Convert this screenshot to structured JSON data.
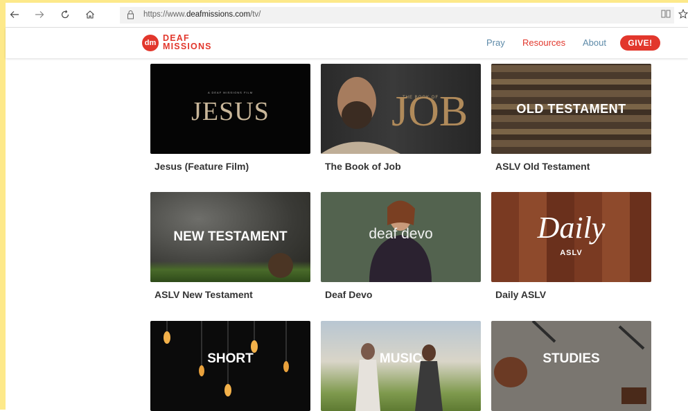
{
  "browser": {
    "url_prefix": "https://www.",
    "url_domain": "deafmissions.com",
    "url_path": "/tv/",
    "back_icon": "arrow-left-icon",
    "forward_icon": "arrow-right-icon",
    "refresh_icon": "refresh-icon",
    "home_icon": "home-icon",
    "reading_icon": "book-icon",
    "favorite_icon": "star-icon"
  },
  "site": {
    "logo_mark": "dm",
    "logo_line1": "DEAF",
    "logo_line2": "MISSIONS",
    "nav": [
      {
        "label": "Pray",
        "color": "#5d8aa8"
      },
      {
        "label": "Resources",
        "color": "#e2372c"
      },
      {
        "label": "About",
        "color": "#5d8aa8"
      }
    ],
    "give_label": "GIVE!",
    "brand_color": "#e2372c"
  },
  "videos": [
    {
      "title": "Jesus (Feature Film)",
      "thumb_small": "A DEAF MISSIONS FILM",
      "thumb_text": "JESUS"
    },
    {
      "title": "The Book of Job",
      "thumb_small": "THE BOOK OF",
      "thumb_text": "JOB"
    },
    {
      "title": "ASLV Old Testament",
      "thumb_text": "OLD TESTAMENT"
    },
    {
      "title": "ASLV New Testament",
      "thumb_text": "NEW TESTAMENT"
    },
    {
      "title": "Deaf Devo",
      "thumb_text": "deaf devo"
    },
    {
      "title": "Daily ASLV",
      "thumb_text": "Daily",
      "thumb_small": "ASLV"
    },
    {
      "title": "",
      "thumb_text": "SHORT"
    },
    {
      "title": "",
      "thumb_text": "MUSIC"
    },
    {
      "title": "",
      "thumb_text": "STUDIES"
    }
  ]
}
